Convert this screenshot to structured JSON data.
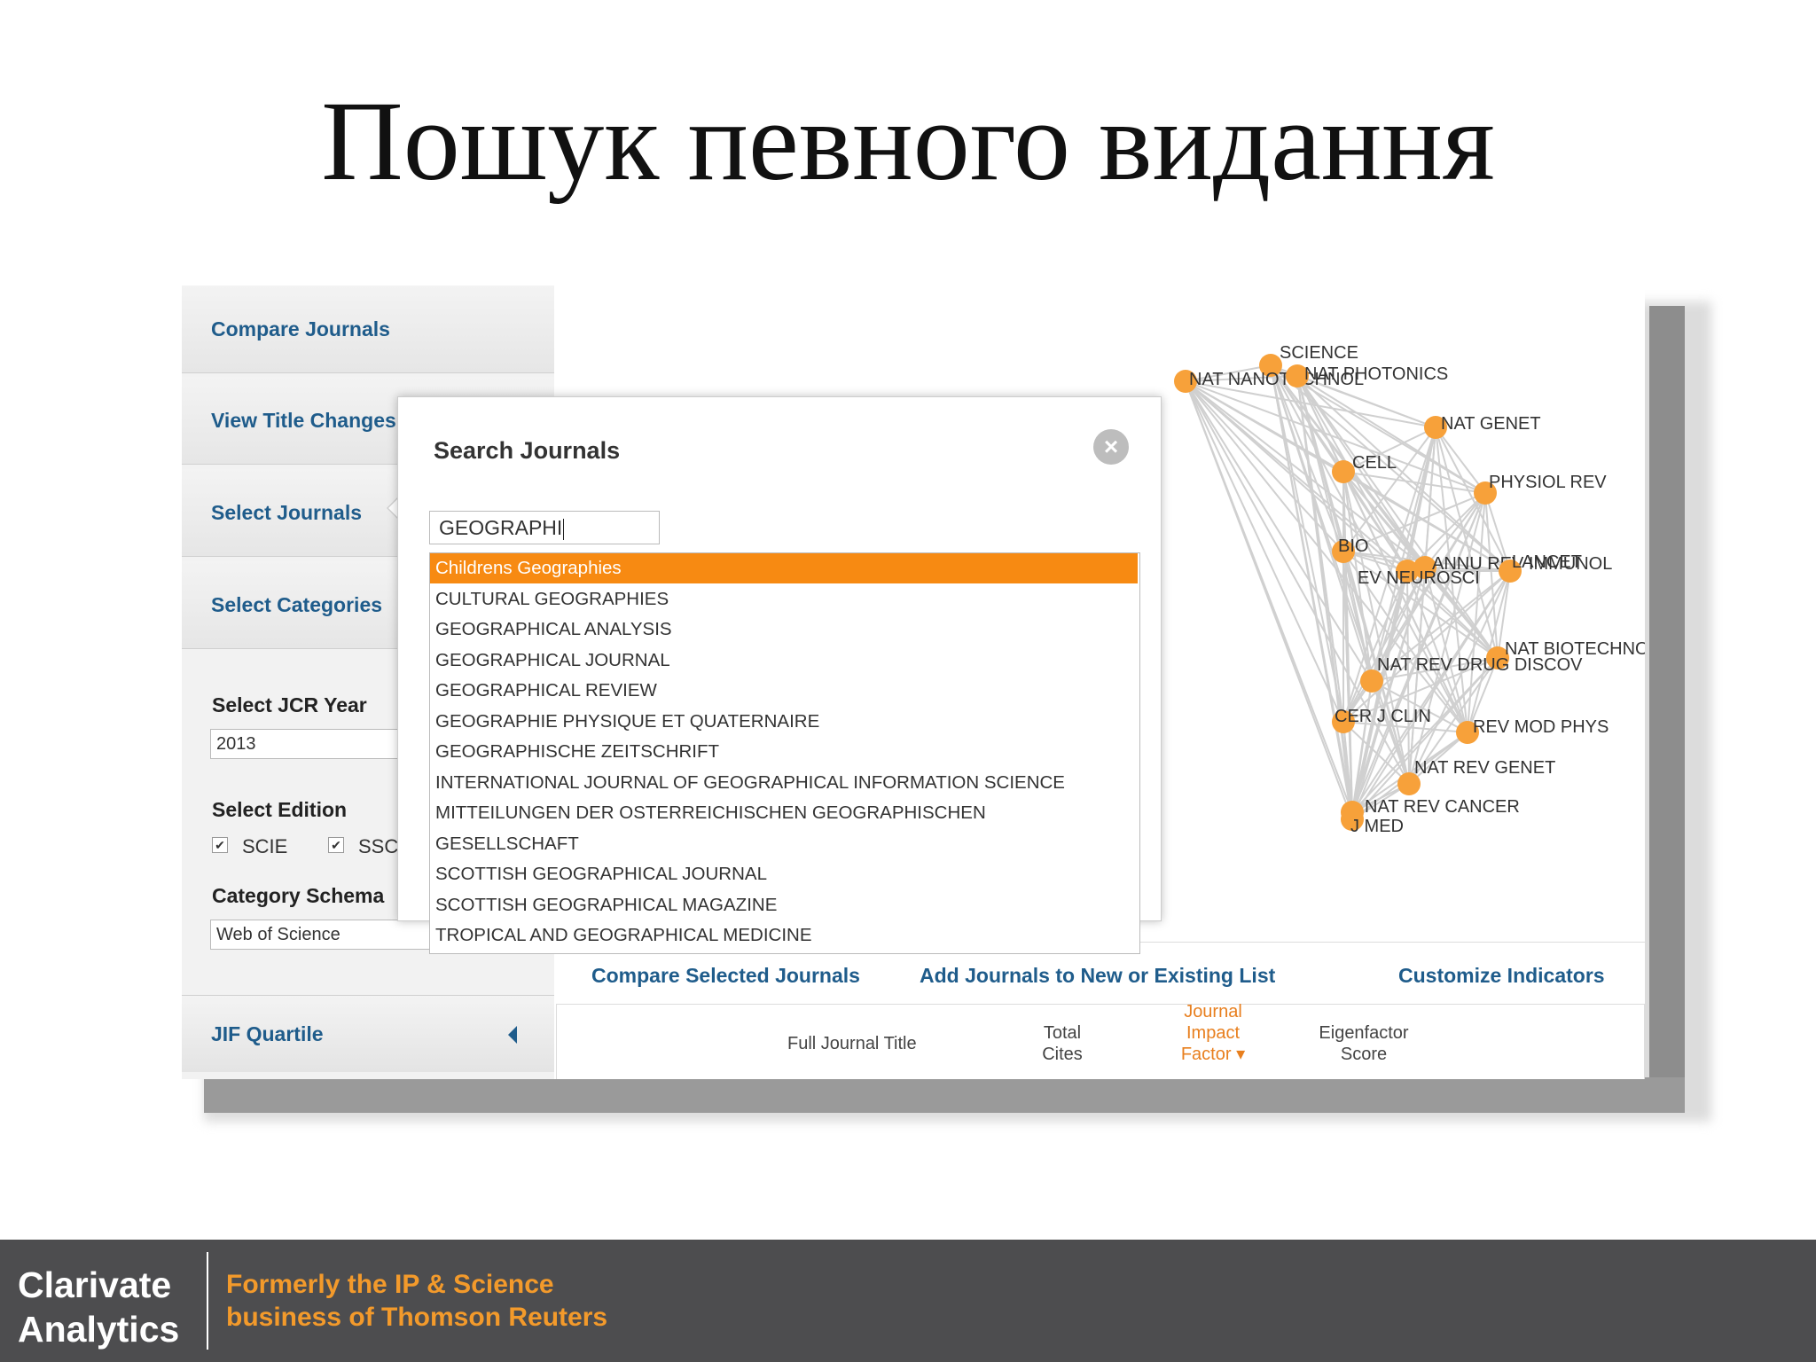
{
  "slide": {
    "title": "Пошук певного видання"
  },
  "sidebar": {
    "tabs": [
      {
        "label": "Compare Journals"
      },
      {
        "label": "View Title Changes"
      },
      {
        "label": "Select Journals"
      },
      {
        "label": "Select Categories"
      }
    ],
    "jcr_year_label": "Select JCR Year",
    "jcr_year_value": "2013",
    "edition_label": "Select Edition",
    "editions": [
      {
        "label": "SCIE",
        "checked": true
      },
      {
        "label": "SSCI",
        "checked": true
      }
    ],
    "schema_label": "Category Schema",
    "schema_value": "Web of Science",
    "jif_quartile": "JIF Quartile"
  },
  "graph": {
    "node_color": "#f7a13a",
    "nodes": [
      {
        "label": "SCIENCE"
      },
      {
        "label": "NAT NANOTECHNOL"
      },
      {
        "label": "NAT PHOTONICS"
      },
      {
        "label": "NAT GENET"
      },
      {
        "label": "CELL"
      },
      {
        "label": "PHYSIOL REV"
      },
      {
        "label": "BIO"
      },
      {
        "label": "ANNU REV IMMUNOL"
      },
      {
        "label": "LANCET"
      },
      {
        "label": "EV NEUROSCI"
      },
      {
        "label": "NAT BIOTECHNOL"
      },
      {
        "label": "NAT REV DRUG DISCOV"
      },
      {
        "label": "CER J CLIN"
      },
      {
        "label": "REV MOD PHYS"
      },
      {
        "label": "NAT REV GENET"
      },
      {
        "label": "NAT REV CANCER"
      },
      {
        "label": "J MED"
      }
    ]
  },
  "actions": {
    "compare": "Compare Selected Journals",
    "add_list": "Add Journals to New or Existing List",
    "customize": "Customize Indicators"
  },
  "table_header": {
    "full_title": "Full Journal Title",
    "total_cites_1": "Total",
    "total_cites_2": "Cites",
    "jif_1": "Journal",
    "jif_2": "Impact",
    "jif_3": "Factor",
    "eigen_1": "Eigenfactor",
    "eigen_2": "Score"
  },
  "modal": {
    "title": "Search Journals",
    "close_glyph": "×",
    "search_value": "GEOGRAPHI",
    "selected_color": "#f78a12",
    "results": [
      "Childrens Geographies",
      "CULTURAL GEOGRAPHIES",
      "GEOGRAPHICAL ANALYSIS",
      "GEOGRAPHICAL JOURNAL",
      "GEOGRAPHICAL REVIEW",
      "GEOGRAPHIE PHYSIQUE ET QUATERNAIRE",
      "GEOGRAPHISCHE ZEITSCHRIFT",
      "INTERNATIONAL JOURNAL OF GEOGRAPHICAL INFORMATION SCIENCE",
      "MITTEILUNGEN DER OSTERREICHISCHEN GEOGRAPHISCHEN",
      "GESELLSCHAFT",
      "SCOTTISH GEOGRAPHICAL JOURNAL",
      "SCOTTISH GEOGRAPHICAL MAGAZINE",
      "TROPICAL AND GEOGRAPHICAL MEDICINE"
    ]
  },
  "footer": {
    "brand_line1": "Clarivate",
    "brand_line2": "Analytics",
    "former_line1": "Formerly the IP & Science",
    "former_line2": "business of Thomson Reuters",
    "accent": "#f39a2b"
  }
}
